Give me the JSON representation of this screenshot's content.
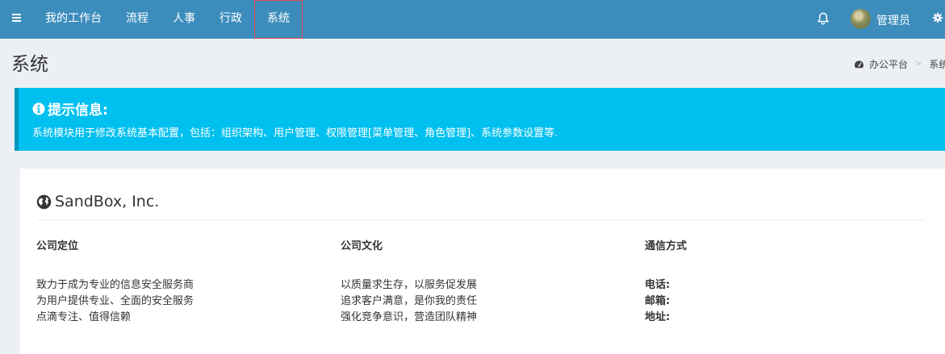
{
  "navbar": {
    "menu": [
      "我的工作台",
      "流程",
      "人事",
      "行政",
      "系统"
    ],
    "active_index": 4,
    "user_name": "管理员"
  },
  "header": {
    "title": "系统",
    "breadcrumb": [
      "办公平台",
      "系统"
    ]
  },
  "callout": {
    "title": "提示信息:",
    "text": "系统模块用于修改系统基本配置，包括：组织架构、用户管理、权限管理[菜单管理、角色管理]、系统参数设置等."
  },
  "company": {
    "name": "SandBox, Inc.",
    "columns": [
      {
        "title": "公司定位",
        "lines": [
          "致力于成为专业的信息安全服务商",
          "为用户提供专业、全面的安全服务",
          "点滴专注、值得信赖"
        ]
      },
      {
        "title": "公司文化",
        "lines": [
          "以质量求生存，以服务促发展",
          "追求客户满意，是你我的责任",
          "强化竞争意识，营造团队精神"
        ]
      },
      {
        "title": "通信方式",
        "lines": [
          "电话:",
          "邮箱:",
          "地址:"
        ]
      }
    ]
  },
  "colors": {
    "navbar": "#3c8dbc",
    "callout": "#00c0ef",
    "active_border": "#e0474c"
  },
  "icons": [
    "menu-icon",
    "bell-icon",
    "avatar",
    "gear-icon",
    "dashboard-icon",
    "info-icon",
    "globe-icon"
  ]
}
